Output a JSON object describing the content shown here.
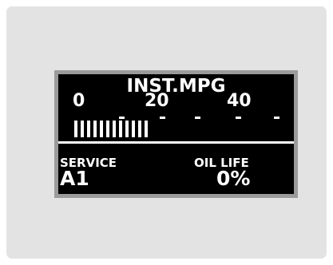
{
  "display": {
    "title": "INST.MPG",
    "scale_labels": [
      "0",
      "20",
      "40"
    ],
    "gauge_segments_lit": 12,
    "service_label": "SERVICE",
    "service_code": "A1",
    "oil_life_label": "OIL LIFE",
    "oil_life_value": "0%"
  },
  "colors": {
    "panel": "#e3e3e3",
    "bezel": "#9b9b9b",
    "screen": "#000000",
    "text": "#ffffff"
  }
}
